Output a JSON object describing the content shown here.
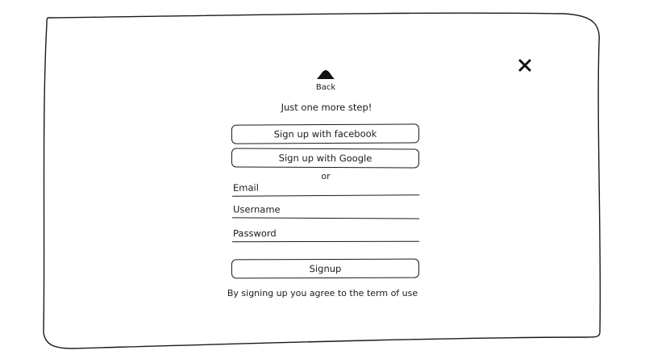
{
  "icons": {
    "close": "close-icon",
    "back": "triangle-up-icon"
  },
  "dialog": {
    "back_label": "Back",
    "heading": "Just one more step!",
    "facebook_label": "Sign up with facebook",
    "google_label": "Sign up with Google",
    "or_text": "or",
    "email_placeholder": "Email",
    "username_placeholder": "Username",
    "password_placeholder": "Password",
    "signup_label": "Signup",
    "terms_text": "By signing up you agree to the term of use"
  }
}
